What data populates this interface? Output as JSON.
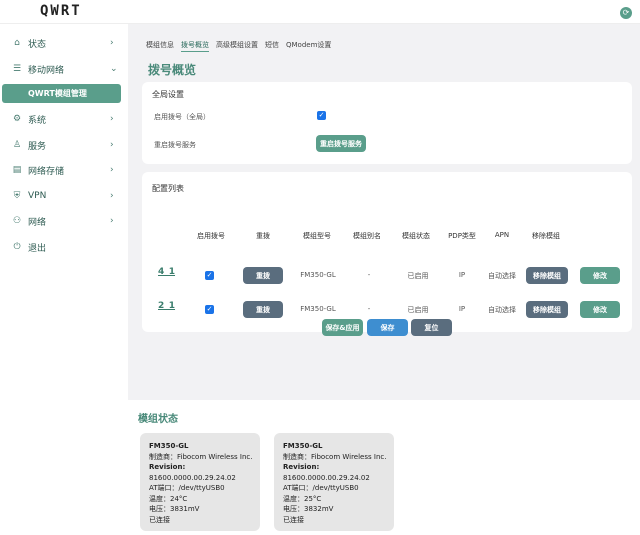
{
  "app": {
    "logo": "QWRT"
  },
  "sidebar": {
    "items": [
      {
        "icon": "home-icon",
        "glyph": "⌂",
        "label": "状态"
      },
      {
        "icon": "database-icon",
        "glyph": "☰",
        "label": "移动网络"
      },
      {
        "icon": "gear-icon",
        "glyph": "⚙",
        "label": "系统"
      },
      {
        "icon": "user-icon",
        "glyph": "♙",
        "label": "服务"
      },
      {
        "icon": "storage-icon",
        "glyph": "▤",
        "label": "网络存储"
      },
      {
        "icon": "vpn-icon",
        "glyph": "⛨",
        "label": "VPN"
      },
      {
        "icon": "network-icon",
        "glyph": "⚇",
        "label": "网络"
      },
      {
        "icon": "power-icon",
        "glyph": "⏻",
        "label": "退出"
      }
    ],
    "sub_item": "QWRT模组管理"
  },
  "tabs": [
    "模组信息",
    "拨号概览",
    "高级模组设置",
    "短信",
    "QModem设置"
  ],
  "page_title": "拨号概览",
  "global": {
    "title": "全局设置",
    "enable_label": "启用拨号（全局）",
    "restart_label": "重启拨号服务",
    "restart_button": "重启拨号服务"
  },
  "config": {
    "title": "配置列表",
    "headers": [
      "启用拨号",
      "重拨",
      "模组型号",
      "模组别名",
      "模组状态",
      "PDP类型",
      "APN",
      "移除模组"
    ],
    "rows": [
      {
        "name": "4_1",
        "redial": "重拨",
        "model": "FM350-GL",
        "alias": "-",
        "status": "已启用",
        "pdp": "IP",
        "apn": "自动选择",
        "remove": "移除模组",
        "edit": "修改"
      },
      {
        "name": "2_1",
        "redial": "重拨",
        "model": "FM350-GL",
        "alias": "-",
        "status": "已启用",
        "pdp": "IP",
        "apn": "自动选择",
        "remove": "移除模组",
        "edit": "修改"
      }
    ]
  },
  "actions": {
    "save_apply": "保存&应用",
    "save": "保存",
    "reset": "复位"
  },
  "module_status": {
    "title": "模组状态",
    "cards": [
      {
        "model": "FM350-GL",
        "maker": "制造商：Fibocom Wireless Inc.",
        "rev_label": "Revision:",
        "rev": "81600.0000.00.29.24.02",
        "at": "AT端口：/dev/ttyUSB0",
        "temp": "温度：24°C",
        "voltage": "电压：3831mV",
        "state": "已连接"
      },
      {
        "model": "FM350-GL",
        "maker": "制造商：Fibocom Wireless Inc.",
        "rev_label": "Revision:",
        "rev": "81600.0000.00.29.24.02",
        "at": "AT端口：/dev/ttyUSB0",
        "temp": "温度：25°C",
        "voltage": "电压：3832mV",
        "state": "已连接"
      }
    ]
  },
  "colors": {
    "accent": "#5a9e8b",
    "slate": "#5a6d7e",
    "blue": "#3e8ed0"
  }
}
